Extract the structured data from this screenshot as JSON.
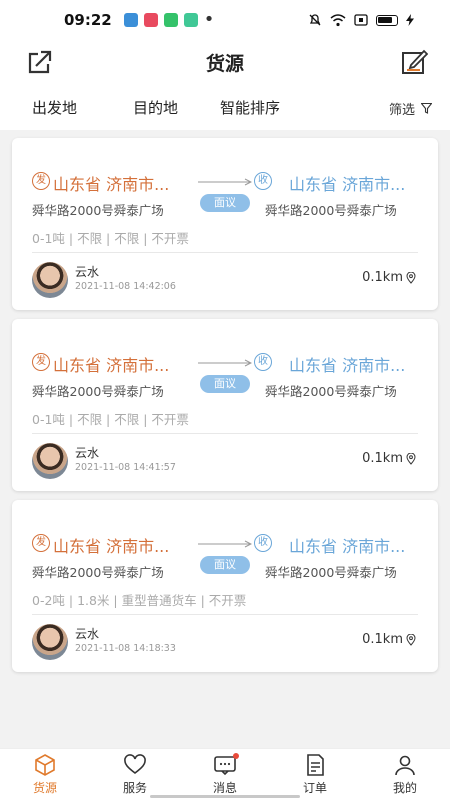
{
  "status_bar": {
    "time": "09:22",
    "app_colors": [
      "#3b8fd8",
      "#e84a5f",
      "#34c26a",
      "#40c896"
    ]
  },
  "header": {
    "title": "货源",
    "left_icon": "share-icon",
    "right_icon": "edit-icon"
  },
  "filters": {
    "origin": "出发地",
    "destination": "目的地",
    "sort": "智能排序",
    "filter": "筛选"
  },
  "cards": [
    {
      "from_badge": "发",
      "to_badge": "收",
      "from_city": "山东省 济南市...",
      "to_city": "山东省 济南市...",
      "from_addr": "舜华路2000号舜泰广场",
      "to_addr": "舜华路2000号舜泰广场",
      "price": "面议",
      "specs": "0-1吨 | 不限 | 不限 | 不开票",
      "user_name": "云水",
      "time": "2021-11-08 14:42:06",
      "distance": "0.1km"
    },
    {
      "from_badge": "发",
      "to_badge": "收",
      "from_city": "山东省 济南市...",
      "to_city": "山东省 济南市...",
      "from_addr": "舜华路2000号舜泰广场",
      "to_addr": "舜华路2000号舜泰广场",
      "price": "面议",
      "specs": "0-1吨 | 不限 | 不限 | 不开票",
      "user_name": "云水",
      "time": "2021-11-08 14:41:57",
      "distance": "0.1km"
    },
    {
      "from_badge": "发",
      "to_badge": "收",
      "from_city": "山东省 济南市...",
      "to_city": "山东省 济南市...",
      "from_addr": "舜华路2000号舜泰广场",
      "to_addr": "舜华路2000号舜泰广场",
      "price": "面议",
      "specs": "0-2吨 | 1.8米 | 重型普通货车 | 不开票",
      "user_name": "云水",
      "time": "2021-11-08 14:18:33",
      "distance": "0.1km"
    }
  ],
  "tabbar": {
    "items": [
      {
        "label": "货源",
        "icon": "box-icon",
        "active": true
      },
      {
        "label": "服务",
        "icon": "heart-icon",
        "active": false
      },
      {
        "label": "消息",
        "icon": "message-icon",
        "active": false,
        "badge": true
      },
      {
        "label": "订单",
        "icon": "order-icon",
        "active": false
      },
      {
        "label": "我的",
        "icon": "user-icon",
        "active": false
      }
    ]
  },
  "colors": {
    "origin": "#d4703a",
    "destination": "#6aa6d8",
    "accent": "#e07a2c",
    "price_tag": "#8fbfe8"
  }
}
